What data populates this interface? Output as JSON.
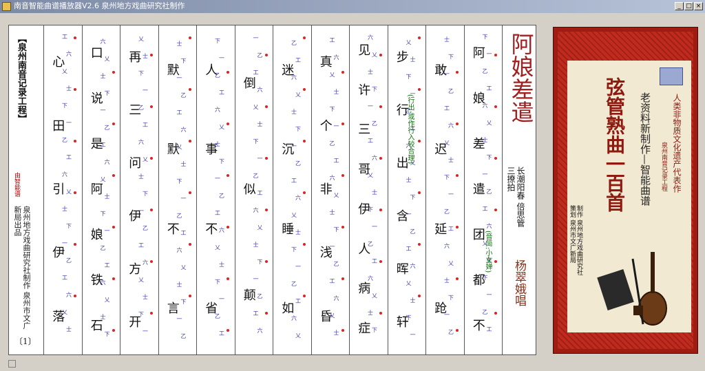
{
  "window": {
    "title": "南音智能曲谱播放器V2.6    泉州地方戏曲研究社制作",
    "minimize_label": "_",
    "maximize_label": "□",
    "close_label": "×"
  },
  "left_panel": {
    "project_title": "【泉州南音记录工程】",
    "tag": "由智能谱",
    "publisher": "泉州地方戏曲研究社制作 泉州市文广新局出品",
    "page": "〔1〕"
  },
  "song": {
    "title": "阿娘差遣",
    "meta": "长潮阳春 倍思管三撩拍",
    "singer": "杨翠娥唱",
    "note_yinjian": "(音简:小女婵)",
    "note_xingchu": "(行出:或作行入较合理)"
  },
  "columns": [
    {
      "chars": [
        "阿",
        "娘",
        "差",
        "遣",
        "团",
        "都",
        "不"
      ]
    },
    {
      "chars": [
        "敢",
        "迟",
        "延",
        "跄"
      ]
    },
    {
      "chars": [
        "步",
        "行",
        "出",
        "含",
        "晖",
        "轩"
      ]
    },
    {
      "chars": [
        "见",
        "许",
        "三",
        "哥",
        "伊",
        "人",
        "病",
        "症"
      ]
    },
    {
      "chars": [
        "真",
        "个",
        "非",
        "浅",
        "昏"
      ]
    },
    {
      "chars": [
        "迷",
        "沉",
        "睡",
        "如"
      ]
    },
    {
      "chars": [
        "倒",
        "似",
        "颠"
      ]
    },
    {
      "chars": [
        "人",
        "事",
        "不",
        "省"
      ]
    },
    {
      "chars": [
        "默",
        "默",
        "不",
        "言"
      ]
    },
    {
      "chars": [
        "再",
        "三",
        "问",
        "伊",
        "方",
        "开"
      ]
    },
    {
      "chars": [
        "口",
        "说",
        "是",
        "阿",
        "娘",
        "铁",
        "石"
      ]
    },
    {
      "chars": [
        "心",
        "田",
        "引",
        "伊",
        "落"
      ]
    }
  ],
  "cover": {
    "title": "弦管熟曲一百首",
    "subtitle": "老资料新制作—智能曲谱",
    "heritage": "人类非物质文化遗产代表作",
    "project": "泉州南音记录工程",
    "credit": "制作 泉州地方戏曲研究社 策划 泉州市文广新局"
  }
}
